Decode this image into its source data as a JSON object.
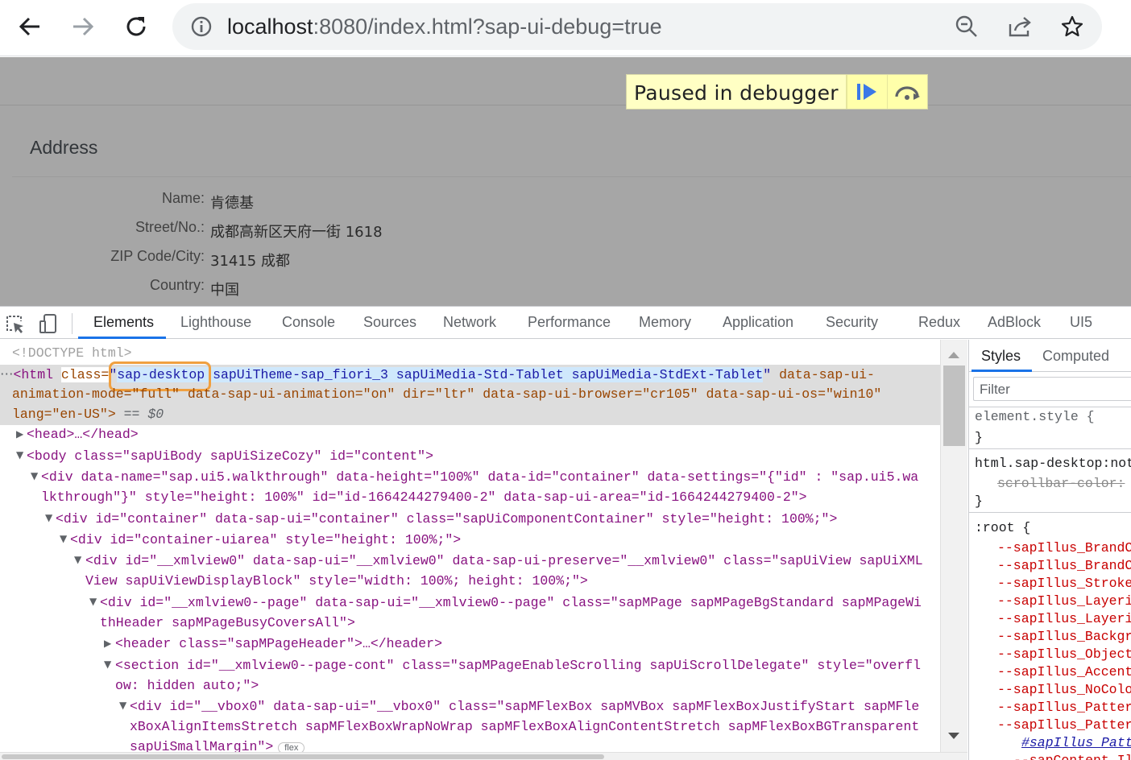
{
  "browser": {
    "url_host": "localhost",
    "url_rest": ":8080/index.html?sap-ui-debug=true"
  },
  "page": {
    "debugger": {
      "label": "Paused in debugger"
    },
    "address": {
      "title": "Address",
      "fields": [
        {
          "label": "Name:",
          "value": "肯德基"
        },
        {
          "label": "Street/No.:",
          "value": "成都高新区天府一街 1618"
        },
        {
          "label": "ZIP Code/City:",
          "value": "31415 成都"
        },
        {
          "label": "Country:",
          "value": "中国"
        }
      ]
    }
  },
  "devtools": {
    "tabs": [
      "Elements",
      "Lighthouse",
      "Console",
      "Sources",
      "Network",
      "Performance",
      "Memory",
      "Application",
      "Security",
      "Redux",
      "AdBlock",
      "UI5"
    ],
    "active_tab": "Elements",
    "dom": {
      "doctype": "<!DOCTYPE html>",
      "html_open": "<html",
      "class_attr": "class=",
      "class_highlight": "sap-desktop",
      "class_rest": " sapUiTheme-sap_fiori_3 sapUiMedia-Std-Tablet sapUiMedia-StdExt-Tablet",
      "html_line1_tail": " data-sap-ui-",
      "html_line2": "animation-mode=\"full\" data-sap-ui-animation=\"on\" dir=\"ltr\" data-sap-ui-browser=\"cr105\" data-sap-ui-os=\"win10\"",
      "html_line3": "lang=\"en-US\">",
      "selected_marker": " == $0",
      "head": "<head>…</head>",
      "body": "<body class=\"sapUiBody sapUiSizeCozy\" id=\"content\">",
      "div1_a": "<div data-name=\"sap.ui5.walkthrough\" data-height=\"100%\" data-id=\"container\" data-settings=\"{\"id\" : \"sap.ui5.wa",
      "div1_b": "lkthrough\"}\" style=\"height: 100%\" id=\"id-1664244279400-2\" data-sap-ui-area=\"id-1664244279400-2\">",
      "div2": "<div id=\"container\" data-sap-ui=\"container\" class=\"sapUiComponentContainer\" style=\"height: 100%;\">",
      "div3": "<div id=\"container-uiarea\" style=\"height: 100%;\">",
      "div4_a": "<div id=\"__xmlview0\" data-sap-ui=\"__xmlview0\" data-sap-ui-preserve=\"__xmlview0\" class=\"sapUiView sapUiXML",
      "div4_b": "View sapUiViewDisplayBlock\" style=\"width: 100%; height: 100%;\">",
      "div5_a": "<div id=\"__xmlview0--page\" data-sap-ui=\"__xmlview0--page\" class=\"sapMPage sapMPageBgStandard sapMPageWi",
      "div5_b": "thHeader sapMPageBusyCoversAll\">",
      "header": "<header class=\"sapMPageHeader\">…</header>",
      "section_a": "<section id=\"__xmlview0--page-cont\" class=\"sapMPageEnableScrolling sapUiScrollDelegate\" style=\"overfl",
      "section_b": "ow: hidden auto;\">",
      "div6_a": "<div id=\"__vbox0\" data-sap-ui=\"__vbox0\" class=\"sapMFlexBox sapMVBox sapMFlexBoxJustifyStart sapMFle",
      "div6_b": "xBoxAlignItemsStretch sapMFlexBoxWrapNoWrap sapMFlexBoxAlignContentStretch sapMFlexBoxBGTransparent",
      "div6_c": "sapUiSmallMargin\">",
      "flex_badge": "flex"
    },
    "styles": {
      "tabs": [
        "Styles",
        "Computed"
      ],
      "filter_placeholder": "Filter",
      "rules": {
        "element_style": "element.style {",
        "close": "}",
        "html_rule": "html.sap-desktop:not",
        "scrollbar": "scrollbar-color:",
        "root": ":root {",
        "vars": [
          "--sapIllus_BrandC",
          "--sapIllus_BrandC",
          "--sapIllus_Stroke",
          "--sapIllus_Layeri",
          "--sapIllus_Layeri",
          "--sapIllus_Backgr",
          "--sapIllus_Object",
          "--sapIllus_Accent",
          "--sapIllus_NoColo",
          "--sapIllus_Patter",
          "--sapIllus_Patter"
        ],
        "link": "#sapIllus_Patt",
        "last": "--sapContent_Illu"
      }
    }
  }
}
